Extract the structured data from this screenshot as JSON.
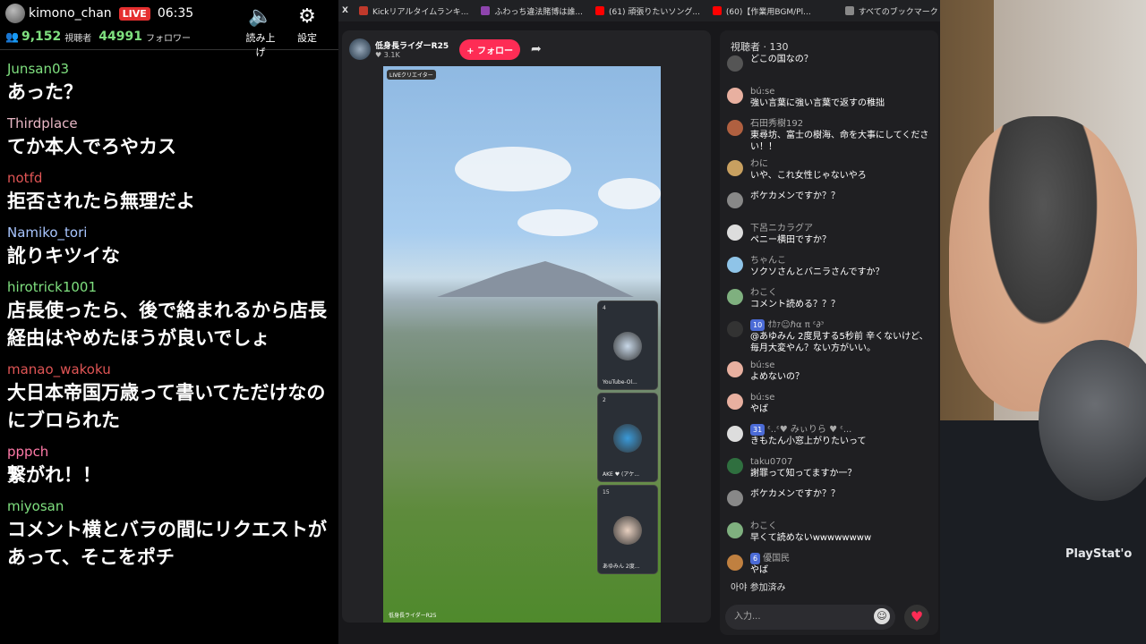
{
  "stream": {
    "username": "kimono_chan",
    "live_label": "LIVE",
    "time": "06:35",
    "viewers": "9,152",
    "viewers_label": "視聴者",
    "followers": "44991",
    "followers_label": "フォロワー",
    "readout_label": "読み上げ",
    "settings_label": "設定"
  },
  "left_messages": [
    {
      "user": "Junsan03",
      "color": "#7fe07f",
      "text": "あった？"
    },
    {
      "user": "Thirdplace",
      "color": "#e8b7c5",
      "text": "てか本人でろやカス"
    },
    {
      "user": "notfd",
      "color": "#e05555",
      "text": "拒否されたら無理だよ"
    },
    {
      "user": "Namiko_tori",
      "color": "#a9c6ff",
      "text": "訛りキツイな"
    },
    {
      "user": "hirotrick1001",
      "color": "#7fe07f",
      "text": "店長使ったら、後で絡まれるから店長経由はやめたほうが良いでしょ"
    },
    {
      "user": "manao_wakoku",
      "color": "#e05555",
      "text": "大日本帝国万歳って書いてただけなのにブロられた"
    },
    {
      "user": "pppch",
      "color": "#ff7aa8",
      "text": "繋がれ！！"
    },
    {
      "user": "miyosan",
      "color": "#7fe07f",
      "text": "コメント横とバラの間にリクエストがあって、そこをポチ"
    }
  ],
  "bookmarks": [
    {
      "label": "Kickリアルタイムランキ...",
      "color": "#c0392b"
    },
    {
      "label": "ふわっち違法賭博は誰...",
      "color": "#8e44ad"
    },
    {
      "label": "(61) 頑張りたいソング...",
      "color": "#ff0000"
    },
    {
      "label": "(60)【作業用BGM/Pl...",
      "color": "#ff0000"
    },
    {
      "label": "すべてのブックマーク",
      "color": "#888888"
    }
  ],
  "player": {
    "channel": "低身長ライダーR25",
    "likes": "♥ 3.1K",
    "follow_label": "+ フォロー",
    "badge": "LIVEクリエイター",
    "video_name": "低身長ライダーR25",
    "guests": [
      {
        "count": "4",
        "label": "YouTube-Ol..."
      },
      {
        "count": "2",
        "label": "AKE ♥ (アケ..."
      },
      {
        "count": "15",
        "label": "あゆみん 2度..."
      }
    ]
  },
  "chat": {
    "title": "視聴者 · 130",
    "messages": [
      {
        "name": "",
        "text": "どこの国なの？",
        "avatar": "#555555"
      },
      {
        "name": "bú:se",
        "text": "強い言葉に強い言葉で返すの稚拙",
        "avatar": "#e8b0a0"
      },
      {
        "name": "石田秀樹192",
        "text": "東尋坊、富士の樹海、命を大事にしてください！！",
        "avatar": "#b06040"
      },
      {
        "name": "わに",
        "text": "いや、これ女性じゃないやろ",
        "avatar": "#c8a060"
      },
      {
        "name": "",
        "text": "ボケカメンですか？？",
        "avatar": "#888888"
      },
      {
        "name": "下呂ニカラグア",
        "text": "ペニー横田ですか？",
        "avatar": "#dddddd"
      },
      {
        "name": "ちゃんこ",
        "text": "ソクソさんとバニラさんですか？",
        "avatar": "#8fc4e8"
      },
      {
        "name": "わこく",
        "text": "コメント読める？？？",
        "avatar": "#7fb07f"
      },
      {
        "name": "ｵｶｧ☺ℏα π ᵋ∂ᵌ",
        "level": "10",
        "text": "@あゆみん 2度見する5秒前 辛くないけど、毎月大変やん？ない方がいい。",
        "avatar": "#333333"
      },
      {
        "name": "bú:se",
        "text": "よめないの？",
        "avatar": "#e8b0a0"
      },
      {
        "name": "bú:se",
        "text": "やば",
        "avatar": "#e8b0a0"
      },
      {
        "name": "ᵋ..ᵋ♥ みぃりら ♥ ᵋ...",
        "level": "31",
        "text": "きもたん小窓上がりたいって",
        "avatar": "#dddddd"
      },
      {
        "name": "taku0707",
        "text": "謝罪って知ってますか一？",
        "avatar": "#2f6f3f"
      },
      {
        "name": "",
        "text": "ボケカメンですか？？",
        "avatar": "#888888"
      },
      {
        "name": "わこく",
        "text": "早くて読めないwwwwwwww",
        "avatar": "#7fb07f"
      },
      {
        "name": "優国民",
        "level": "6",
        "text": "やば",
        "avatar": "#c08040"
      }
    ],
    "joined_text": "아야 参加済み",
    "input_placeholder": "入力..."
  },
  "webcam": {
    "shirt_text": "PlayStat'o"
  }
}
